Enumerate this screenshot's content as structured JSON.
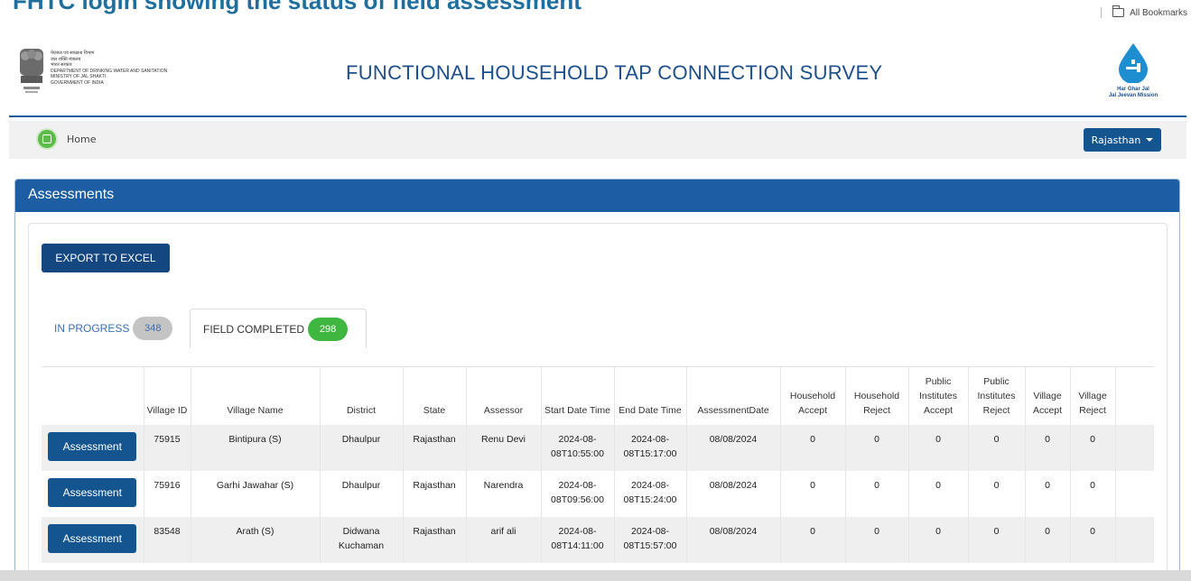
{
  "banner": {
    "cut_title": "FHTC login showing the status of field assessment",
    "bookmarks_label": "All Bookmarks"
  },
  "header": {
    "ministry_lines": [
      "पेयजल एवं स्वच्छता विभाग",
      "जल शक्ति मंत्रालय",
      "भारत सरकार",
      "DEPARTMENT OF DRINKING WATER AND SANITATION",
      "MINISTRY OF JAL SHAKTI",
      "GOVERNMENT OF INDIA"
    ],
    "title": "FUNCTIONAL HOUSEHOLD TAP CONNECTION SURVEY",
    "logo_line1": "Har Ghar Jal",
    "logo_line2": "Jal Jeevan Mission"
  },
  "nav": {
    "home_label": "Home",
    "state_selected": "Rajasthan"
  },
  "panel": {
    "title": "Assessments",
    "export_label": "EXPORT TO EXCEL",
    "tabs": [
      {
        "label": "IN PROGRESS",
        "count": "348"
      },
      {
        "label": "FIELD COMPLETED",
        "count": "298"
      }
    ]
  },
  "table": {
    "headers": [
      "",
      "Village ID",
      "Village Name",
      "District",
      "State",
      "Assessor",
      "Start Date Time",
      "End Date Time",
      "AssessmentDate",
      "Household Accept",
      "Household Reject",
      "Public Institutes Accept",
      "Public Institutes Reject",
      "Village Accept",
      "Village Reject",
      ""
    ],
    "rows": [
      {
        "action": "Assessment",
        "village_id": "75915",
        "village_name": "Bintipura (S)",
        "district": "Dhaulpur",
        "state": "Rajasthan",
        "assessor": "Renu Devi",
        "start": "2024-08-08T10:55:00",
        "end": "2024-08-08T15:17:00",
        "date": "08/08/2024",
        "hh_accept": "0",
        "hh_reject": "0",
        "pi_accept": "0",
        "pi_reject": "0",
        "v_accept": "0",
        "v_reject": "0"
      },
      {
        "action": "Assessment",
        "village_id": "75916",
        "village_name": "Garhi Jawahar (S)",
        "district": "Dhaulpur",
        "state": "Rajasthan",
        "assessor": "Narendra",
        "start": "2024-08-08T09:56:00",
        "end": "2024-08-08T15:24:00",
        "date": "08/08/2024",
        "hh_accept": "0",
        "hh_reject": "0",
        "pi_accept": "0",
        "pi_reject": "0",
        "v_accept": "0",
        "v_reject": "0"
      },
      {
        "action": "Assessment",
        "village_id": "83548",
        "village_name": "Arath (S)",
        "district": "Didwana Kuchaman",
        "state": "Rajasthan",
        "assessor": "arif ali",
        "start": "2024-08-08T14:11:00",
        "end": "2024-08-08T15:57:00",
        "date": "08/08/2024",
        "hh_accept": "0",
        "hh_reject": "0",
        "pi_accept": "0",
        "pi_reject": "0",
        "v_accept": "0",
        "v_reject": "0"
      }
    ]
  },
  "colors": {
    "brand_blue": "#1d5da4",
    "button_blue": "#14558f",
    "badge_green": "#3fb63f"
  }
}
